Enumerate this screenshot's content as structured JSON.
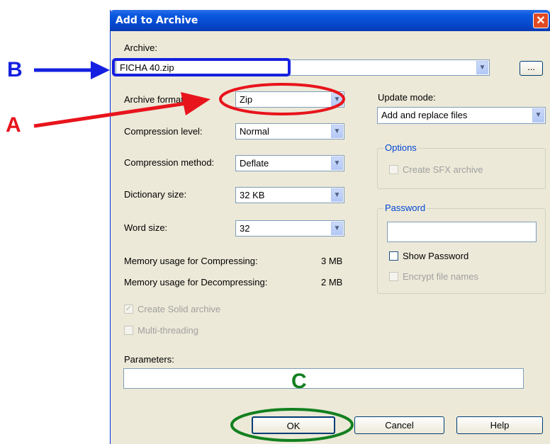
{
  "dialog": {
    "title": "Add to Archive",
    "close_symbol": "✕"
  },
  "archive": {
    "label": "Archive:",
    "value": "FICHA 40.zip",
    "browse_label": "..."
  },
  "left": {
    "archive_format": {
      "label": "Archive format:",
      "value": "Zip"
    },
    "compression_level": {
      "label": "Compression level:",
      "value": "Normal"
    },
    "compression_method": {
      "label": "Compression method:",
      "value": "Deflate"
    },
    "dictionary_size": {
      "label": "Dictionary size:",
      "value": "32 KB"
    },
    "word_size": {
      "label": "Word size:",
      "value": "32"
    },
    "memory_compress": {
      "label": "Memory usage for Compressing:",
      "value": "3 MB"
    },
    "memory_decompress": {
      "label": "Memory usage for Decompressing:",
      "value": "2 MB"
    },
    "solid_archive": {
      "label": "Create Solid archive",
      "checked": true,
      "enabled": false
    },
    "multithreading": {
      "label": "Multi-threading",
      "checked": false,
      "enabled": false
    },
    "parameters": {
      "label": "Parameters:",
      "value": ""
    }
  },
  "right": {
    "update_mode": {
      "label": "Update mode:",
      "value": "Add and replace files"
    },
    "options": {
      "title": "Options",
      "sfx_label": "Create SFX archive"
    },
    "password": {
      "title": "Password",
      "value": "",
      "show_label": "Show Password",
      "encrypt_label": "Encrypt file names"
    }
  },
  "buttons": {
    "ok": "OK",
    "cancel": "Cancel",
    "help": "Help"
  },
  "annotations": {
    "a": {
      "letter": "A",
      "color": "#e8141c"
    },
    "b": {
      "letter": "B",
      "color": "#1520e0"
    },
    "c": {
      "letter": "C",
      "color": "#13801f"
    }
  },
  "icons": {
    "dropdown": "chevron-down-icon",
    "check": "checkmark-icon"
  }
}
